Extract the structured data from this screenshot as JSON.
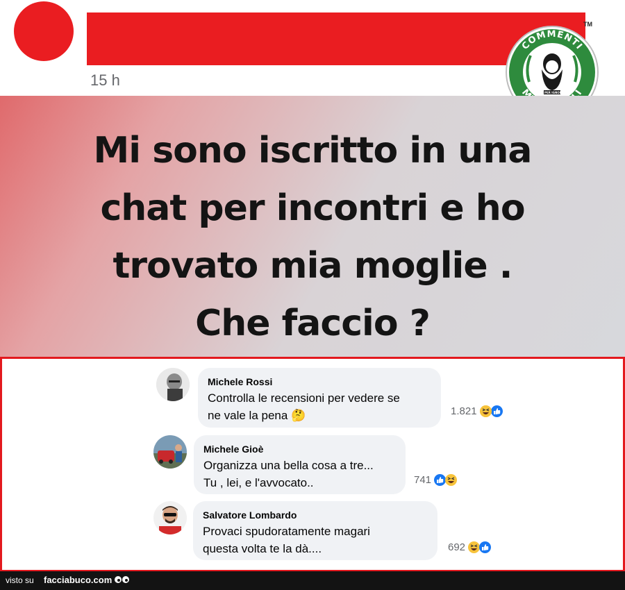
{
  "header": {
    "time": "15 h",
    "trademark": "TM"
  },
  "badge": {
    "text_top": "COMMENTI",
    "text_bottom": "MEMORABILI",
    "inner_text": "NATI PER IGNORARE"
  },
  "post": {
    "lines": [
      "Mi sono iscritto in una",
      "chat per incontri e ho",
      "trovato mia moglie .",
      "Che faccio ?"
    ]
  },
  "comments": [
    {
      "name": "Michele Rossi",
      "text": "Controlla le recensioni per vedere se\nne vale la pena 🤔",
      "count": "1.821",
      "reactions": [
        "haha-icon",
        "like-icon"
      ]
    },
    {
      "name": "Michele Gioè",
      "text": "Organizza una bella cosa a tre...\nTu , lei, e l'avvocato..",
      "count": "741",
      "reactions": [
        "like-icon",
        "haha-icon"
      ]
    },
    {
      "name": "Salvatore Lombardo",
      "text": "Provaci spudoratamente magari\nquesta volta te la dà....",
      "count": "692",
      "reactions": [
        "haha-icon",
        "like-icon"
      ]
    }
  ],
  "footer": {
    "visto_su": "visto su",
    "brand": "facciabuco.com"
  },
  "colors": {
    "redaction": "#ea1d21",
    "frame_border": "#e3191e",
    "badge_green": "#2e8b3d",
    "like_blue": "#1877f2",
    "haha_yellow": "#f7c33b"
  }
}
